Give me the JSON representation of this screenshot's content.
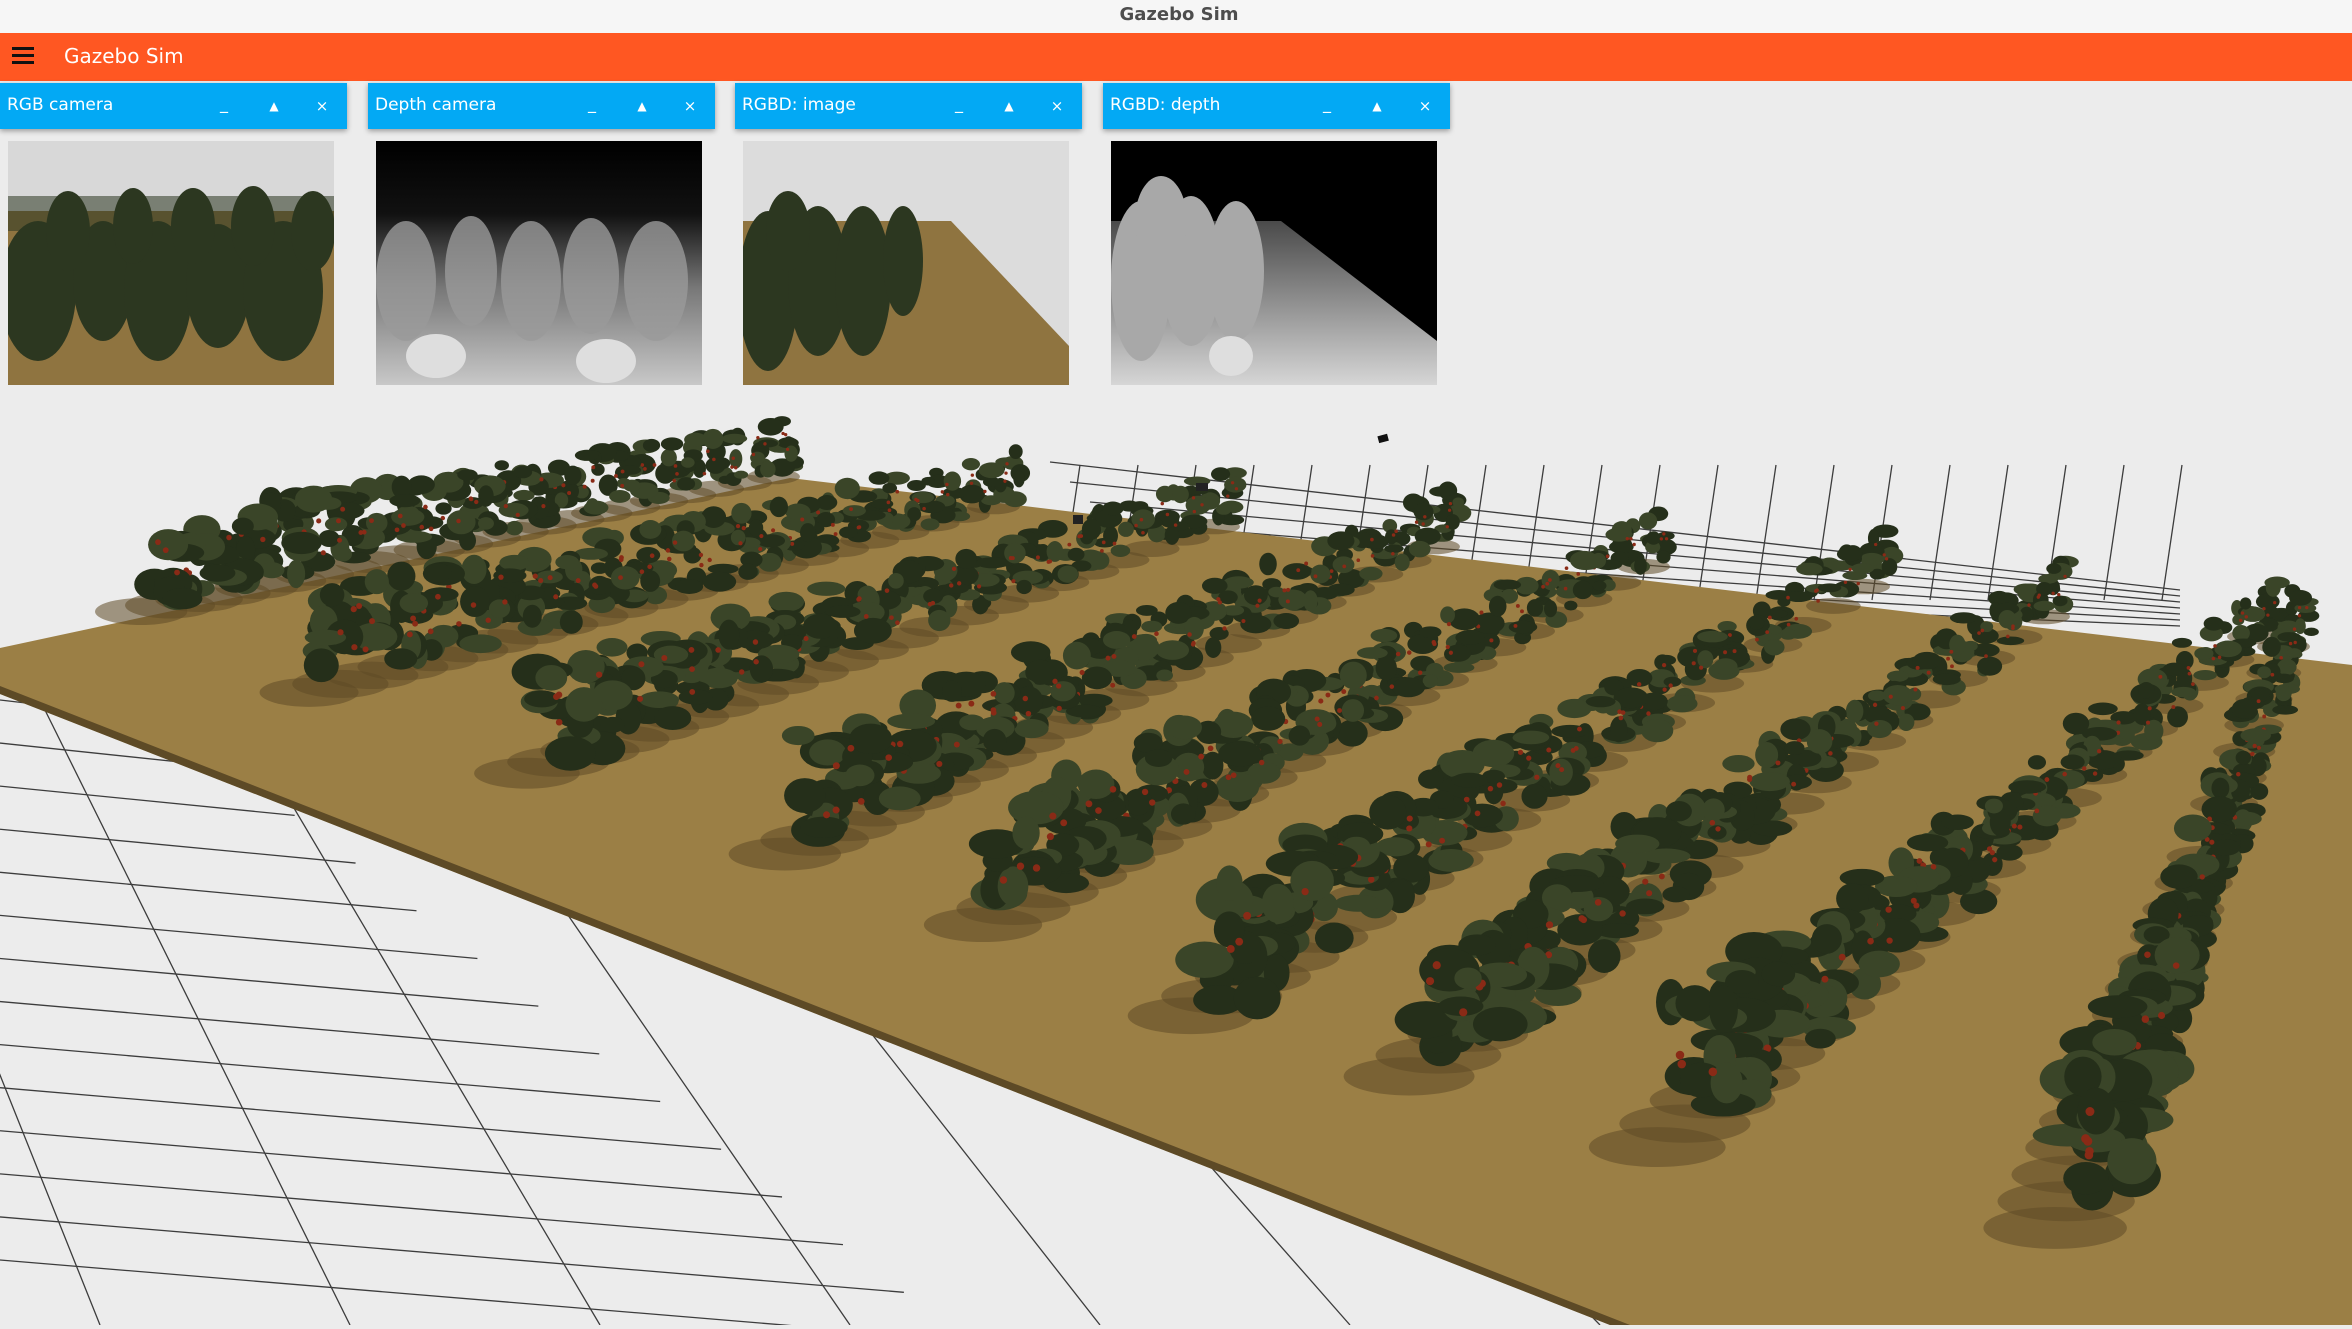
{
  "window": {
    "title": "Gazebo Sim"
  },
  "appbar": {
    "title": "Gazebo Sim",
    "menu_icon": "hamburger-menu-icon"
  },
  "plugins": [
    {
      "label": "RGB camera"
    },
    {
      "label": "Depth camera"
    },
    {
      "label": "RGBD: image"
    },
    {
      "label": "RGBD: depth"
    }
  ],
  "plugin_buttons": {
    "minimize": "_",
    "collapse": "▲",
    "close": "×"
  },
  "colors": {
    "appbar": "#ff5722",
    "plugin_header": "#03a9f4",
    "ground": "#9b7f45",
    "foliage": "#2e3a22",
    "grid_floor": "#ececec"
  }
}
